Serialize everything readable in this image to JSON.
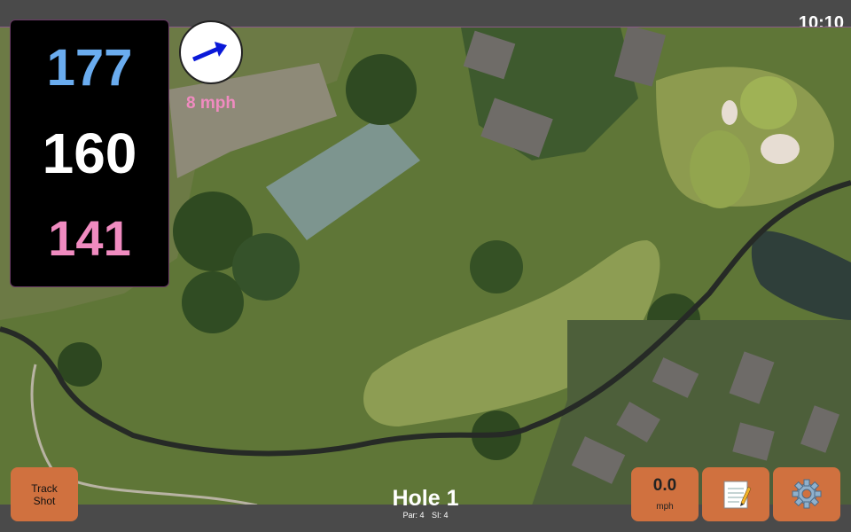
{
  "status": {
    "time": "10:10"
  },
  "yardages": {
    "back": "177",
    "middle": "160",
    "front": "141"
  },
  "wind": {
    "speed_label": "8 mph",
    "arrow_icon": "arrow-right-icon"
  },
  "hole": {
    "title": "Hole 1",
    "par": "Par: 4",
    "si": "SI: 4"
  },
  "buttons": {
    "track_shot": {
      "line1": "Track",
      "line2": "Shot"
    },
    "wind_speed": {
      "value": "0.0",
      "unit": "mph"
    },
    "notes": {
      "icon": "notepad-icon"
    },
    "settings": {
      "icon": "gear-icon"
    }
  },
  "colors": {
    "back": "#6aacef",
    "middle": "#ffffff",
    "front": "#f08bc0",
    "button": "#d0713f",
    "bar": "#4a4a4a"
  }
}
